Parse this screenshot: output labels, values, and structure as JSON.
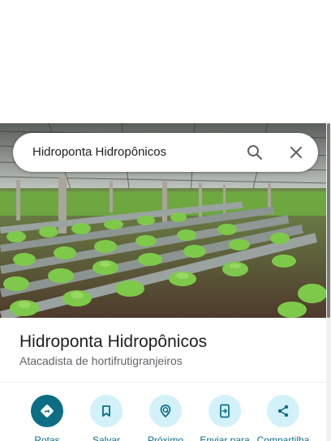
{
  "search": {
    "query": "Hidroponta Hidropônicos"
  },
  "place": {
    "name": "Hidroponta Hidropônicos",
    "category": "Atacadista de hortifrutigranjeiros"
  },
  "actions": [
    {
      "label": "Rotas",
      "icon": "directions-icon"
    },
    {
      "label": "Salvar",
      "icon": "bookmark-icon"
    },
    {
      "label": "Próximo",
      "icon": "nearby-icon"
    },
    {
      "label": "Enviar para",
      "icon": "send-to-phone-icon"
    },
    {
      "label": "Compartilha",
      "icon": "share-icon"
    }
  ],
  "colors": {
    "accent": "#0b6e85",
    "action_bg": "#d2f1f9",
    "title": "#202124",
    "secondary_text": "#5f6368"
  }
}
